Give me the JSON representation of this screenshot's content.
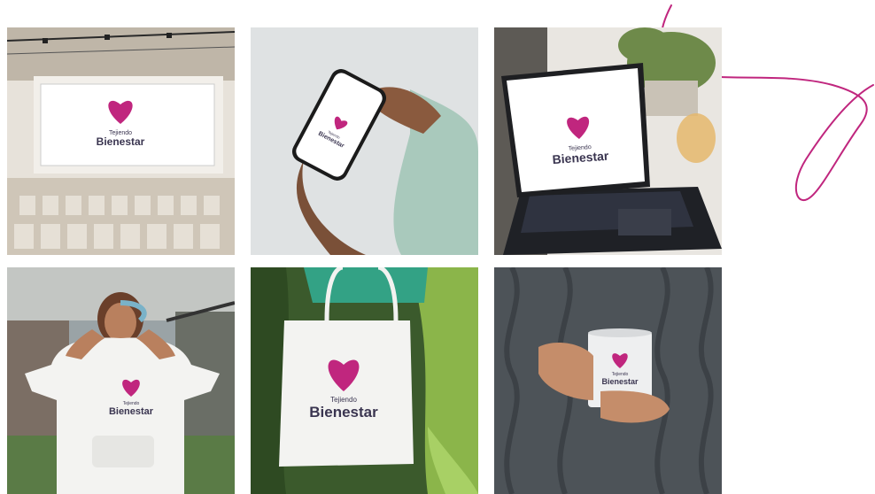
{
  "brand": {
    "line1": "Tejiendo",
    "line2": "Bienestar",
    "heart_color": "#c0267e",
    "text_color": "#3a3550"
  },
  "mockups": [
    {
      "scene": "auditorium-screen"
    },
    {
      "scene": "smartphone-in-hand"
    },
    {
      "scene": "laptop-on-desk"
    },
    {
      "scene": "girl-in-hoodie"
    },
    {
      "scene": "tote-bag"
    },
    {
      "scene": "mug-in-hands"
    }
  ],
  "decoration": {
    "color": "#c0267e"
  }
}
